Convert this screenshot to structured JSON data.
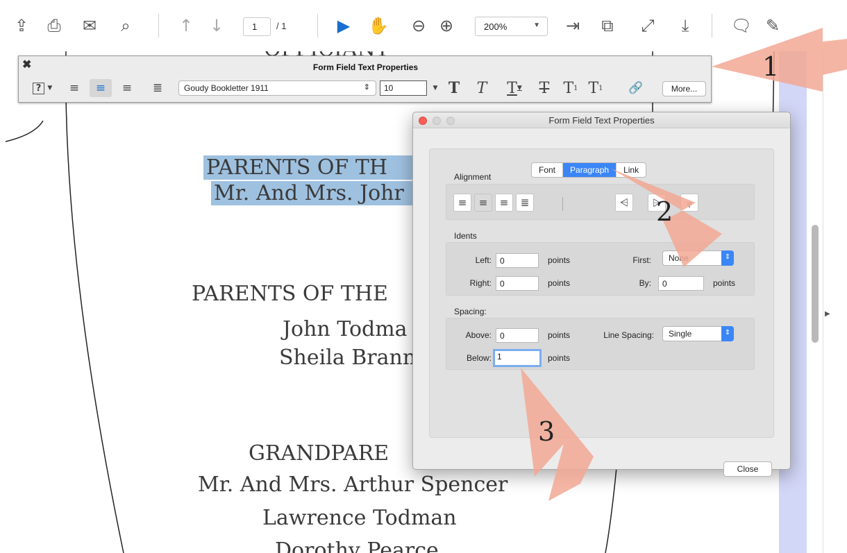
{
  "toolbar": {
    "page_current": "1",
    "page_total": "/ 1",
    "zoom": "200%",
    "icons": [
      "cloud-upload-icon",
      "print-icon",
      "mail-icon",
      "search-icon",
      "previous-page-icon",
      "next-page-icon",
      "select-cursor-icon",
      "hand-icon",
      "zoom-out-icon",
      "zoom-in-icon",
      "fit-width-icon",
      "fit-page-icon",
      "full-screen-icon",
      "read-mode-icon",
      "comment-icon",
      "sign-icon"
    ]
  },
  "document": {
    "lines": [
      {
        "text": "OFFICIANT"
      },
      {
        "text": "PARENTS OF TH"
      },
      {
        "text": "Mr. And Mrs. Johr"
      },
      {
        "text": "PARENTS OF THE"
      },
      {
        "text": "John Todma"
      },
      {
        "text": "Sheila Brann"
      },
      {
        "text": "GRANDPARE"
      },
      {
        "text": "Mr. And Mrs. Arthur Spencer"
      },
      {
        "text": "Lawrence Todman"
      },
      {
        "text": "Dorothy Pearce"
      }
    ]
  },
  "form_toolbar": {
    "title": "Form Field Text Properties",
    "font_name": "Goudy Bookletter 1911",
    "font_size": "10",
    "more_label": "More..."
  },
  "dialog": {
    "title": "Form Field Text Properties",
    "tabs": [
      "Font",
      "Paragraph",
      "Link"
    ],
    "active_tab": "Paragraph",
    "alignment_label": "Alignment",
    "indents_label": "Idents",
    "left_label": "Left:",
    "left_value": "0",
    "right_label": "Right:",
    "right_value": "0",
    "points_label": "points",
    "first_label": "First:",
    "first_value": "None",
    "by_label": "By:",
    "by_value": "0",
    "spacing_label": "Spacing:",
    "above_label": "Above:",
    "above_value": "0",
    "below_label": "Below:",
    "below_value": "1",
    "line_spacing_label": "Line Spacing:",
    "line_spacing_value": "Single",
    "close_label": "Close"
  },
  "annotations": [
    "1",
    "2",
    "3"
  ],
  "colors": {
    "accent": "#3b86f6",
    "highlight": "#9fc1e0",
    "arrow": "#f2a894"
  }
}
